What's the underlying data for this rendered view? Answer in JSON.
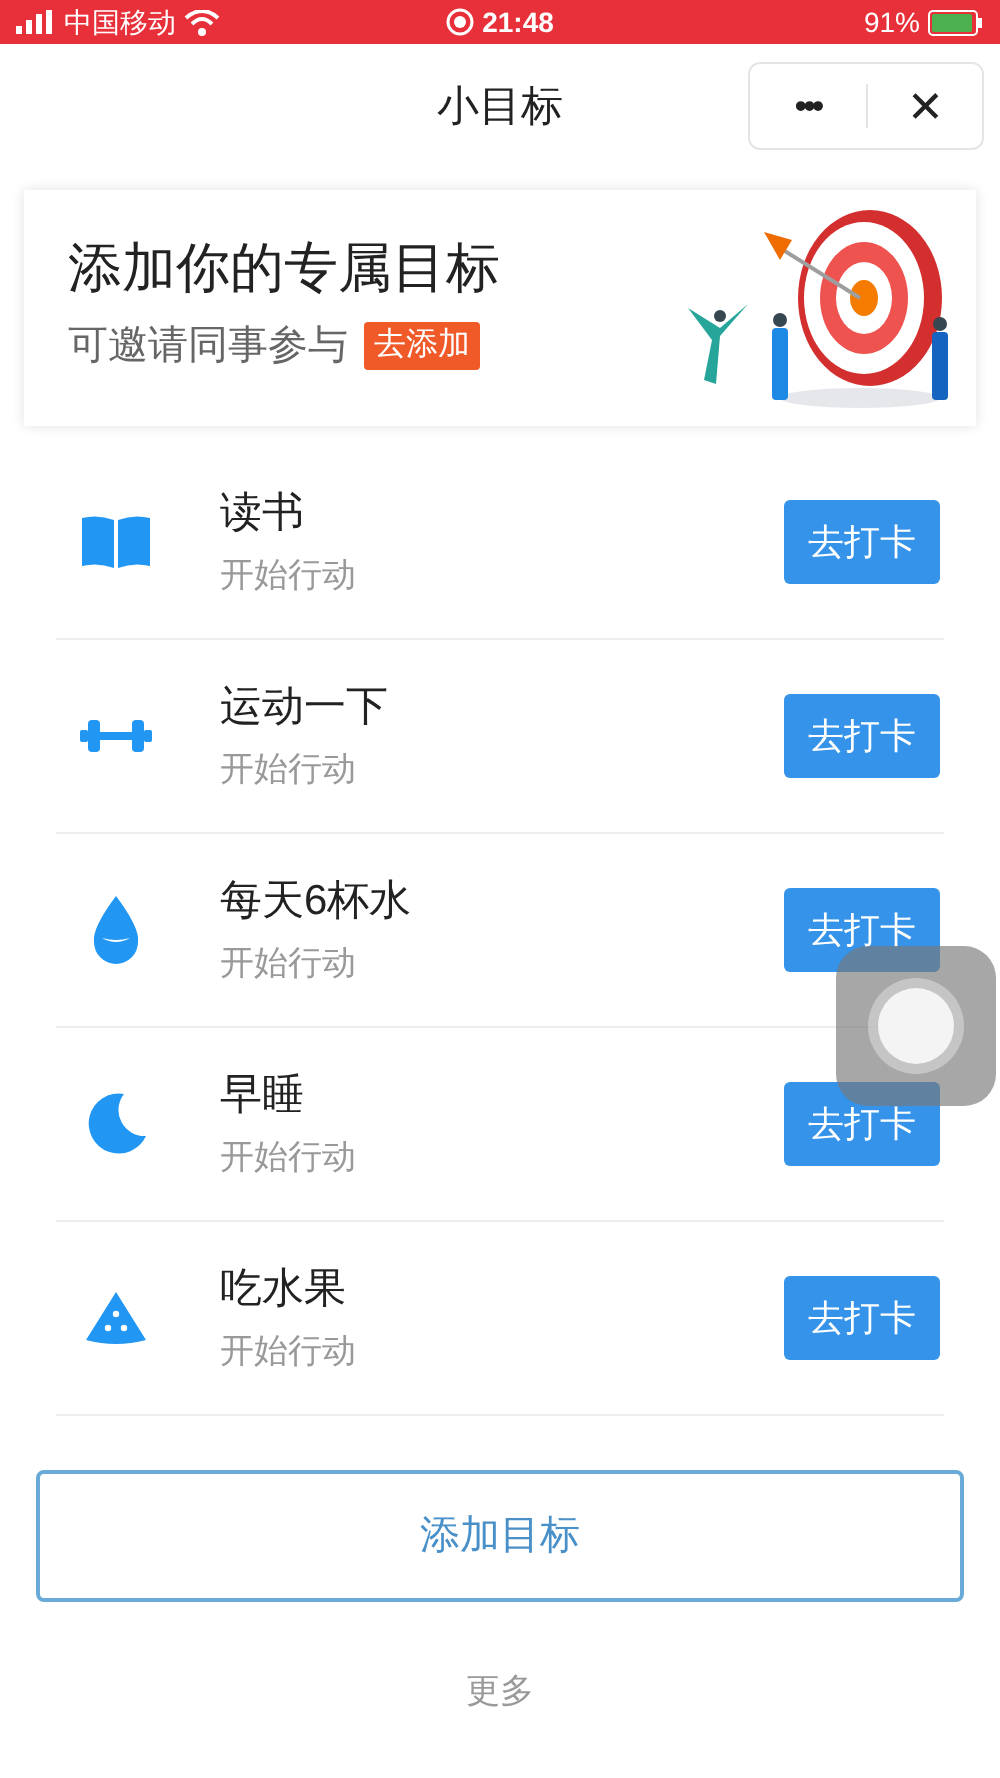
{
  "status_bar": {
    "carrier": "中国移动",
    "time": "21:48",
    "battery": "91%"
  },
  "nav": {
    "title": "小目标",
    "more": "•••",
    "close": "✕"
  },
  "banner": {
    "title": "添加你的专属目标",
    "subtitle": "可邀请同事参与",
    "action": "去添加"
  },
  "goals": [
    {
      "kind": "book",
      "name": "读书",
      "status": "开始行动",
      "action": "去打卡"
    },
    {
      "kind": "dumbbell",
      "name": "运动一下",
      "status": "开始行动",
      "action": "去打卡"
    },
    {
      "kind": "drop",
      "name": "每天6杯水",
      "status": "开始行动",
      "action": "去打卡"
    },
    {
      "kind": "moon",
      "name": "早睡",
      "status": "开始行动",
      "action": "去打卡"
    },
    {
      "kind": "watermelon",
      "name": "吃水果",
      "status": "开始行动",
      "action": "去打卡"
    }
  ],
  "add_button": "添加目标",
  "more_link": "更多"
}
